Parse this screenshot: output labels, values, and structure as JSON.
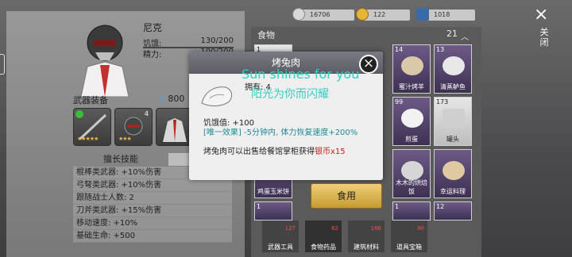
{
  "character": {
    "name": "尼克",
    "hunger_label": "饥饿:",
    "hunger_value": "130/200",
    "energy_label": "精力:",
    "energy_value": "100/200"
  },
  "equipment": {
    "title": "武器装备",
    "power": "800",
    "slot2_level": "4"
  },
  "tabs": {
    "skills": "擅长技能",
    "other": "精"
  },
  "skills": [
    "棍棒类武器: +10%伤害",
    "弓弩类武器: +10%伤害",
    "跟随战士人数: 2",
    "刀斧类武器: +15%伤害",
    "移动速度: +10%",
    "基础生命: +500"
  ],
  "currency": {
    "silver": "16706",
    "gold": "122",
    "tickets": "1018"
  },
  "inventory": {
    "title": "食物",
    "count": "21",
    "cells": [
      {
        "n": "1",
        "label": ""
      },
      {
        "n": "14",
        "label": "蜜汁烤羊"
      },
      {
        "n": "13",
        "label": "清蒸鲈鱼"
      },
      {
        "n": "99",
        "label": "煎蛋"
      },
      {
        "n": "173",
        "label": "罐头"
      },
      {
        "n": "",
        "label": "鸡蛋玉米饼"
      },
      {
        "n": "",
        "label": "木木的烘焙饭"
      },
      {
        "n": "",
        "label": "幸运料理"
      },
      {
        "n": "1",
        "label": ""
      },
      {
        "n": "1",
        "label": ""
      },
      {
        "n": "12",
        "label": ""
      }
    ],
    "bottom_tabs": [
      {
        "label": "武器工具",
        "badge": "127"
      },
      {
        "label": "食物药品",
        "badge": "62"
      },
      {
        "label": "建筑材料",
        "badge": "166"
      },
      {
        "label": "道具宝箱",
        "badge": "90"
      }
    ]
  },
  "close": {
    "icon": "×",
    "label": "关闭"
  },
  "popup": {
    "title": "烤兔肉",
    "overlay_line1": "Sun shines for you",
    "overlay_line2": "阳光为你而闪耀",
    "owned": "拥有: 4",
    "hunger": "饥饿值: +100",
    "effect_tag": "[唯一效果]",
    "effect_text": " -5分钟内, 体力恢复速度+200%",
    "sell_text": "烤兔肉可以出售给餐馆掌柜获得",
    "sell_reward": "银币x15",
    "use_button": "食用"
  }
}
